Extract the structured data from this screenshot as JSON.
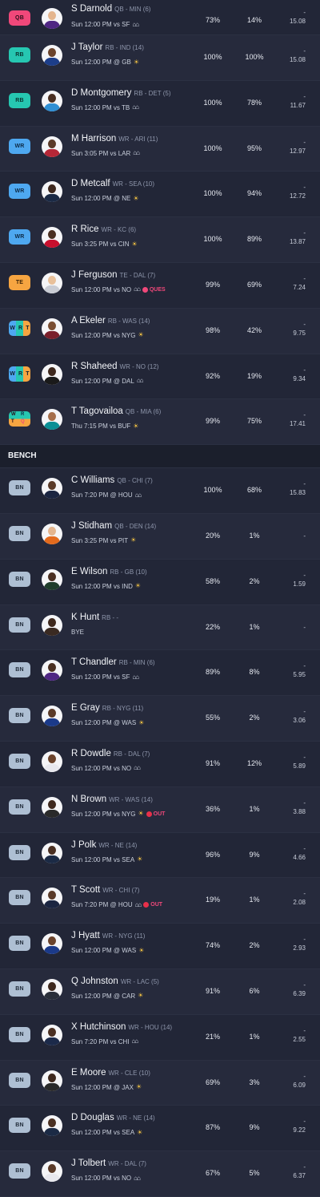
{
  "section": {
    "bench_label": "BENCH"
  },
  "starters": [
    {
      "pos": "QB",
      "name": "S Darnold",
      "meta": "QB - MIN (6)",
      "game": "Sun 12:00 PM vs SF",
      "weather": "dome",
      "status": "",
      "start": "73%",
      "roster": "14%",
      "proj_dash": "-",
      "proj": "15.08",
      "skin": "#e4b58e",
      "team": "#4f2683"
    },
    {
      "pos": "RB",
      "name": "J Taylor",
      "meta": "RB - IND (14)",
      "game": "Sun 12:00 PM @ GB",
      "weather": "sun",
      "status": "",
      "start": "100%",
      "roster": "100%",
      "proj_dash": "-",
      "proj": "15.08",
      "skin": "#6b432b",
      "team": "#1d3e8a"
    },
    {
      "pos": "RB",
      "name": "D Montgomery",
      "meta": "RB - DET (5)",
      "game": "Sun 12:00 PM vs TB",
      "weather": "dome",
      "status": "",
      "start": "100%",
      "roster": "78%",
      "proj_dash": "-",
      "proj": "11.67",
      "skin": "#4a2f21",
      "team": "#2f8fd4"
    },
    {
      "pos": "WR",
      "name": "M Harrison",
      "meta": "WR - ARI (11)",
      "game": "Sun 3:05 PM vs LAR",
      "weather": "dome",
      "status": "",
      "start": "100%",
      "roster": "95%",
      "proj_dash": "-",
      "proj": "12.97",
      "skin": "#5a3a28",
      "team": "#b52737"
    },
    {
      "pos": "WR",
      "name": "D Metcalf",
      "meta": "WR - SEA (10)",
      "game": "Sun 12:00 PM @ NE",
      "weather": "sun",
      "status": "",
      "start": "100%",
      "roster": "94%",
      "proj_dash": "-",
      "proj": "12.72",
      "skin": "#3e281d",
      "team": "#1b2a45"
    },
    {
      "pos": "WR",
      "name": "R Rice",
      "meta": "WR - KC (6)",
      "game": "Sun 3:25 PM vs CIN",
      "weather": "sun",
      "status": "",
      "start": "100%",
      "roster": "89%",
      "proj_dash": "-",
      "proj": "13.87",
      "skin": "#4a2f21",
      "team": "#c8102e"
    },
    {
      "pos": "TE",
      "name": "J Ferguson",
      "meta": "TE - DAL (7)",
      "game": "Sun 12:00 PM vs NO",
      "weather": "dome",
      "status": "QUES",
      "start": "99%",
      "roster": "69%",
      "proj_dash": "-",
      "proj": "7.24",
      "skin": "#e8c09a",
      "team": "#c9ccd4"
    },
    {
      "pos": "FLEX",
      "name": "A Ekeler",
      "meta": "RB - WAS (14)",
      "game": "Sun 12:00 PM vs NYG",
      "weather": "sun",
      "status": "",
      "start": "98%",
      "roster": "42%",
      "proj_dash": "-",
      "proj": "9.75",
      "skin": "#7a4e32",
      "team": "#7a1f2b"
    },
    {
      "pos": "FLEX",
      "name": "R Shaheed",
      "meta": "WR - NO (12)",
      "game": "Sun 12:00 PM @ DAL",
      "weather": "dome",
      "status": "",
      "start": "92%",
      "roster": "19%",
      "proj_dash": "-",
      "proj": "9.34",
      "skin": "#3e281d",
      "team": "#1a1a1a"
    },
    {
      "pos": "SFLEX",
      "name": "T Tagovailoa",
      "meta": "QB - MIA (6)",
      "game": "Thu 7:15 PM vs BUF",
      "weather": "sun",
      "status": "",
      "start": "99%",
      "roster": "75%",
      "proj_dash": "-",
      "proj": "17.41",
      "skin": "#a56e4a",
      "team": "#0a8f95"
    }
  ],
  "flex_letters": [
    "W",
    "R",
    "T"
  ],
  "sflex_letters": [
    "W",
    "R",
    "T",
    "Q"
  ],
  "bench": [
    {
      "pos": "BN",
      "name": "C Williams",
      "meta": "QB - CHI (7)",
      "game": "Sun 7:20 PM @ HOU",
      "weather": "dome",
      "status": "",
      "start": "100%",
      "roster": "68%",
      "proj_dash": "-",
      "proj": "15.83",
      "skin": "#5a3a28",
      "team": "#1b2541"
    },
    {
      "pos": "BN",
      "name": "J Stidham",
      "meta": "QB - DEN (14)",
      "game": "Sun 3:25 PM vs PIT",
      "weather": "sun",
      "status": "",
      "start": "20%",
      "roster": "1%",
      "proj_dash": "",
      "proj": "-",
      "skin": "#e4b58e",
      "team": "#e36a1d"
    },
    {
      "pos": "BN",
      "name": "E Wilson",
      "meta": "RB - GB (10)",
      "game": "Sun 12:00 PM vs IND",
      "weather": "sun",
      "status": "",
      "start": "58%",
      "roster": "2%",
      "proj_dash": "-",
      "proj": "1.59",
      "skin": "#4a2f21",
      "team": "#1f3d2b"
    },
    {
      "pos": "BN",
      "name": "K Hunt",
      "meta": "RB - -",
      "game": "BYE",
      "weather": "",
      "status": "",
      "start": "22%",
      "roster": "1%",
      "proj_dash": "",
      "proj": "-",
      "skin": "#3e281d",
      "team": "#3a2a22"
    },
    {
      "pos": "BN",
      "name": "T Chandler",
      "meta": "RB - MIN (6)",
      "game": "Sun 12:00 PM vs SF",
      "weather": "dome",
      "status": "",
      "start": "89%",
      "roster": "8%",
      "proj_dash": "-",
      "proj": "5.95",
      "skin": "#4a2f21",
      "team": "#4f2683"
    },
    {
      "pos": "BN",
      "name": "E Gray",
      "meta": "RB - NYG (11)",
      "game": "Sun 12:00 PM @ WAS",
      "weather": "sun",
      "status": "",
      "start": "55%",
      "roster": "2%",
      "proj_dash": "-",
      "proj": "3.06",
      "skin": "#5a3a28",
      "team": "#1b3a8a"
    },
    {
      "pos": "BN",
      "name": "R Dowdle",
      "meta": "RB - DAL (7)",
      "game": "Sun 12:00 PM vs NO",
      "weather": "dome",
      "status": "",
      "start": "91%",
      "roster": "12%",
      "proj_dash": "-",
      "proj": "5.89",
      "skin": "#6b432b",
      "team": "#e8e8ee"
    },
    {
      "pos": "BN",
      "name": "N Brown",
      "meta": "WR - WAS (14)",
      "game": "Sun 12:00 PM vs NYG",
      "weather": "sun",
      "status": "OUT",
      "start": "36%",
      "roster": "1%",
      "proj_dash": "-",
      "proj": "3.88",
      "skin": "#3e281d",
      "team": "#2a2a2a"
    },
    {
      "pos": "BN",
      "name": "J Polk",
      "meta": "WR - NE (14)",
      "game": "Sun 12:00 PM vs SEA",
      "weather": "sun",
      "status": "",
      "start": "96%",
      "roster": "9%",
      "proj_dash": "-",
      "proj": "4.66",
      "skin": "#4a2f21",
      "team": "#1b2a45"
    },
    {
      "pos": "BN",
      "name": "T Scott",
      "meta": "WR - CHI (7)",
      "game": "Sun 7:20 PM @ HOU",
      "weather": "dome",
      "status": "OUT",
      "start": "19%",
      "roster": "1%",
      "proj_dash": "-",
      "proj": "2.08",
      "skin": "#5a3a28",
      "team": "#1b2541"
    },
    {
      "pos": "BN",
      "name": "J Hyatt",
      "meta": "WR - NYG (11)",
      "game": "Sun 12:00 PM @ WAS",
      "weather": "sun",
      "status": "",
      "start": "74%",
      "roster": "2%",
      "proj_dash": "-",
      "proj": "2.93",
      "skin": "#6b432b",
      "team": "#1b3a8a"
    },
    {
      "pos": "BN",
      "name": "Q Johnston",
      "meta": "WR - LAC (5)",
      "game": "Sun 12:00 PM @ CAR",
      "weather": "sun",
      "status": "",
      "start": "91%",
      "roster": "6%",
      "proj_dash": "-",
      "proj": "6.39",
      "skin": "#3e281d",
      "team": "#2a2f3a"
    },
    {
      "pos": "BN",
      "name": "X Hutchinson",
      "meta": "WR - HOU (14)",
      "game": "Sun 7:20 PM vs CHI",
      "weather": "dome",
      "status": "",
      "start": "21%",
      "roster": "1%",
      "proj_dash": "-",
      "proj": "2.55",
      "skin": "#4a2f21",
      "team": "#1c2a4a"
    },
    {
      "pos": "BN",
      "name": "E Moore",
      "meta": "WR - CLE (10)",
      "game": "Sun 12:00 PM @ JAX",
      "weather": "sun",
      "status": "",
      "start": "69%",
      "roster": "3%",
      "proj_dash": "-",
      "proj": "6.09",
      "skin": "#3e281d",
      "team": "#2a2a2a"
    },
    {
      "pos": "BN",
      "name": "D Douglas",
      "meta": "WR - NE (14)",
      "game": "Sun 12:00 PM vs SEA",
      "weather": "sun",
      "status": "",
      "start": "87%",
      "roster": "9%",
      "proj_dash": "-",
      "proj": "9.22",
      "skin": "#4a2f21",
      "team": "#1b2a45"
    },
    {
      "pos": "BN",
      "name": "J Tolbert",
      "meta": "WR - DAL (7)",
      "game": "Sun 12:00 PM vs NO",
      "weather": "dome",
      "status": "",
      "start": "67%",
      "roster": "5%",
      "proj_dash": "-",
      "proj": "6.37",
      "skin": "#5a3a28",
      "team": "#e8e8ee"
    }
  ]
}
